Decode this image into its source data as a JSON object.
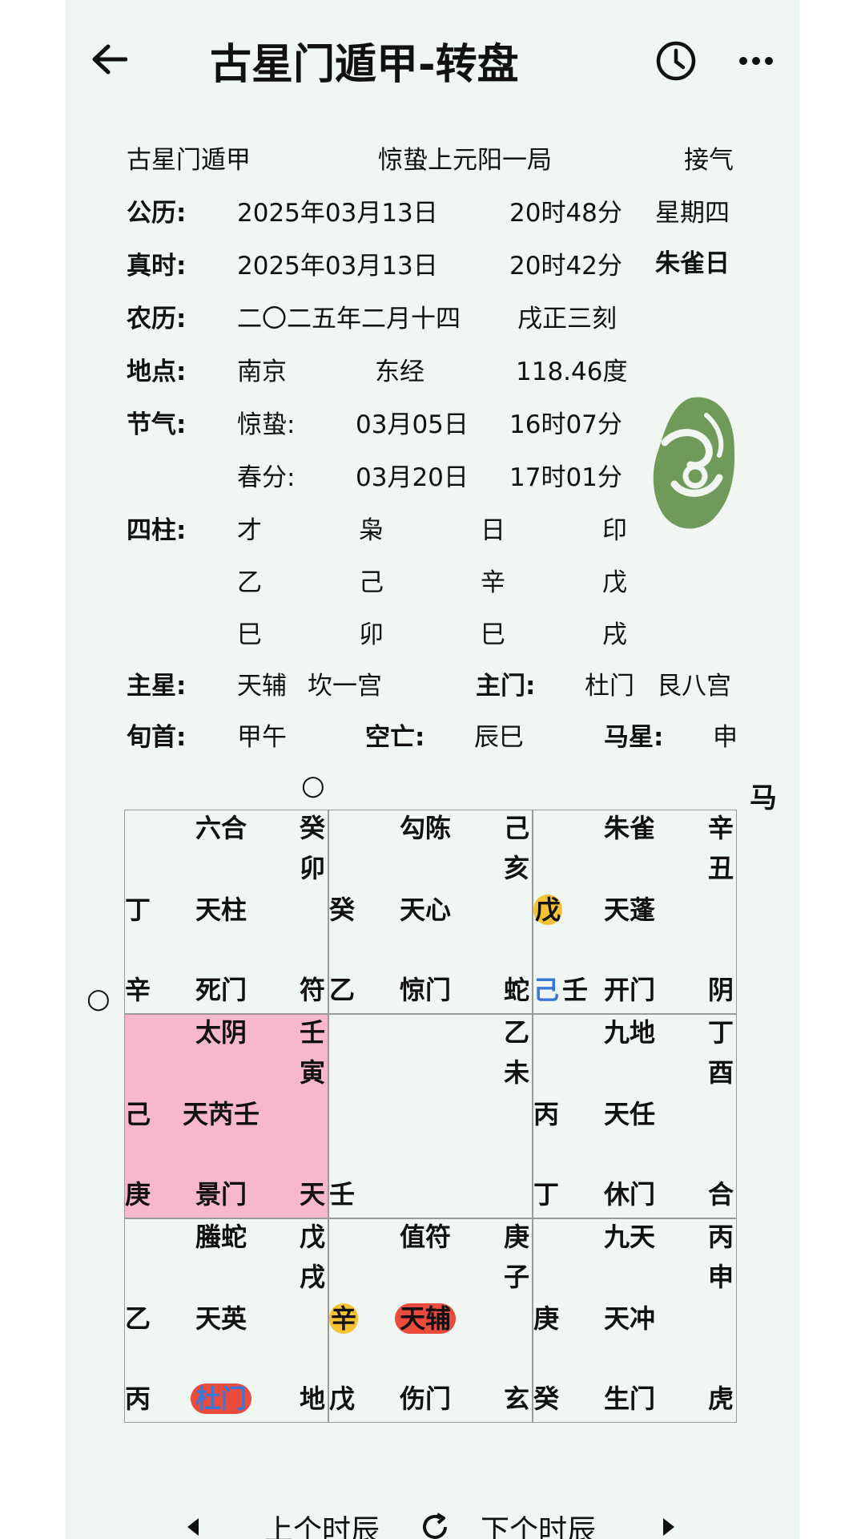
{
  "header": {
    "title": "古星门遁甲-转盘",
    "back_icon": "arrow-left-icon",
    "history_icon": "clock-icon",
    "more_icon": "more-dots-icon"
  },
  "info": {
    "system": "古星门遁甲",
    "ju": "惊蛰上元阳一局",
    "qi": "接气",
    "solar_label": "公历:",
    "solar_date": "2025年03月13日",
    "solar_time": "20时48分",
    "weekday": "星期四",
    "true_label": "真时:",
    "true_date": "2025年03月13日",
    "true_time": "20时42分",
    "day_god": "朱雀日",
    "lunar_label": "农历:",
    "lunar_date": "二〇二五年二月十四",
    "lunar_time": "戌正三刻",
    "place_label": "地点:",
    "place": "南京",
    "long_label": "东经",
    "long_value": "118.46度",
    "term_label": "节气:",
    "term1_name": "惊蛰:",
    "term1_date": "03月05日",
    "term1_time": "16时07分",
    "term2_name": "春分:",
    "term2_date": "03月20日",
    "term2_time": "17时01分",
    "pillars_label": "四柱:",
    "pillars": {
      "shishen": [
        "才",
        "枭",
        "日",
        "印"
      ],
      "stems": [
        "乙",
        "己",
        "辛",
        "戊"
      ],
      "branches": [
        "巳",
        "卯",
        "巳",
        "戌"
      ]
    },
    "star_label": "主星:",
    "star": "天辅",
    "star_palace": "坎一宫",
    "door_label": "主门:",
    "door": "杜门",
    "door_palace": "艮八宫",
    "xun_label": "旬首:",
    "xun": "甲午",
    "kong_label": "空亡:",
    "kong": "辰巳",
    "horse_label": "马星:",
    "horse": "申"
  },
  "board": {
    "marker_top": "○",
    "marker_left": "○",
    "horse_mark": "马",
    "cells": [
      {
        "god": "六合",
        "tr1": "癸",
        "tr2": "卯",
        "left": "丁",
        "star": "天柱",
        "bl": "辛",
        "door": "死门",
        "br": "符"
      },
      {
        "god": "勾陈",
        "tr1": "己",
        "tr2": "亥",
        "left": "癸",
        "star": "天心",
        "bl": "乙",
        "door": "惊门",
        "br": "蛇"
      },
      {
        "god": "朱雀",
        "tr1": "辛",
        "tr2": "丑",
        "left": "戊",
        "star": "天蓬",
        "bl_a": "己",
        "bl_b": "壬",
        "door": "开门",
        "br": "阴"
      },
      {
        "god": "太阴",
        "tr1": "壬",
        "tr2": "寅",
        "left": "己",
        "star": "天芮壬",
        "bl": "庚",
        "door": "景门",
        "br": "天"
      },
      {
        "tr1": "乙",
        "tr2": "未",
        "bl": "壬"
      },
      {
        "god": "九地",
        "tr1": "丁",
        "tr2": "酉",
        "left": "丙",
        "star": "天任",
        "bl": "丁",
        "door": "休门",
        "br": "合"
      },
      {
        "god": "螣蛇",
        "tr1": "戊",
        "tr2": "戌",
        "left": "乙",
        "star": "天英",
        "bl": "丙",
        "door": "杜门",
        "br": "地"
      },
      {
        "god": "值符",
        "tr1": "庚",
        "tr2": "子",
        "left": "辛",
        "star": "天辅",
        "bl": "戊",
        "door": "伤门",
        "br": "玄"
      },
      {
        "god": "九天",
        "tr1": "丙",
        "tr2": "申",
        "left": "庚",
        "star": "天冲",
        "bl": "癸",
        "door": "生门",
        "br": "虎"
      }
    ]
  },
  "footer": {
    "prev": "上个时辰",
    "next": "下个时辰",
    "refresh_icon": "refresh-icon",
    "prev_icon": "caret-left-icon",
    "next_icon": "caret-right-icon"
  },
  "colors": {
    "highlight_cell": "#f7b8cd",
    "logo_green": "#6f9a5a",
    "yellow_pill": "#f6c233",
    "red_pill": "#ea4b3c",
    "blue_text": "#3a78d8"
  }
}
